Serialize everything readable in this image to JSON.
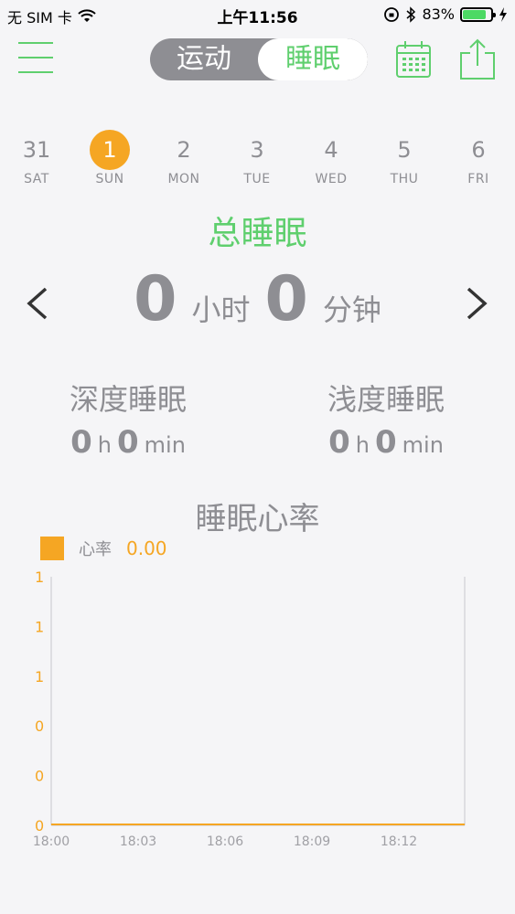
{
  "status": {
    "carrier": "无 SIM 卡",
    "time": "上午11:56",
    "battery": "83%",
    "battery_level": 0.83
  },
  "nav": {
    "segments": [
      "运动",
      "睡眠"
    ],
    "active_segment": "睡眠"
  },
  "week": [
    {
      "num": "31",
      "label": "SAT"
    },
    {
      "num": "1",
      "label": "SUN",
      "active": true
    },
    {
      "num": "2",
      "label": "MON"
    },
    {
      "num": "3",
      "label": "TUE"
    },
    {
      "num": "4",
      "label": "WED"
    },
    {
      "num": "5",
      "label": "THU"
    },
    {
      "num": "6",
      "label": "FRI"
    }
  ],
  "total": {
    "title": "总睡眠",
    "hours": "0",
    "hours_unit": "小时",
    "minutes": "0",
    "minutes_unit": "分钟"
  },
  "deep": {
    "title": "深度睡眠",
    "h": "0",
    "h_unit": "h",
    "m": "0",
    "m_unit": "min"
  },
  "light": {
    "title": "浅度睡眠",
    "h": "0",
    "h_unit": "h",
    "m": "0",
    "m_unit": "min"
  },
  "heart": {
    "title": "睡眠心率",
    "legend_name": "心率",
    "legend_value": "0.00"
  },
  "chart_data": {
    "type": "line",
    "x": [
      "18:00",
      "18:03",
      "18:06",
      "18:09",
      "18:12"
    ],
    "y_tick_labels": [
      "1",
      "1",
      "1",
      "0",
      "0",
      "0"
    ],
    "series": [
      {
        "name": "心率",
        "values": [
          0,
          0,
          0,
          0,
          0
        ]
      }
    ],
    "ylim": [
      0,
      1
    ],
    "color": "#f5a623"
  },
  "colors": {
    "accent_green": "#5fcf6e",
    "accent_orange": "#f5a623",
    "text_gray": "#8e8e93"
  }
}
